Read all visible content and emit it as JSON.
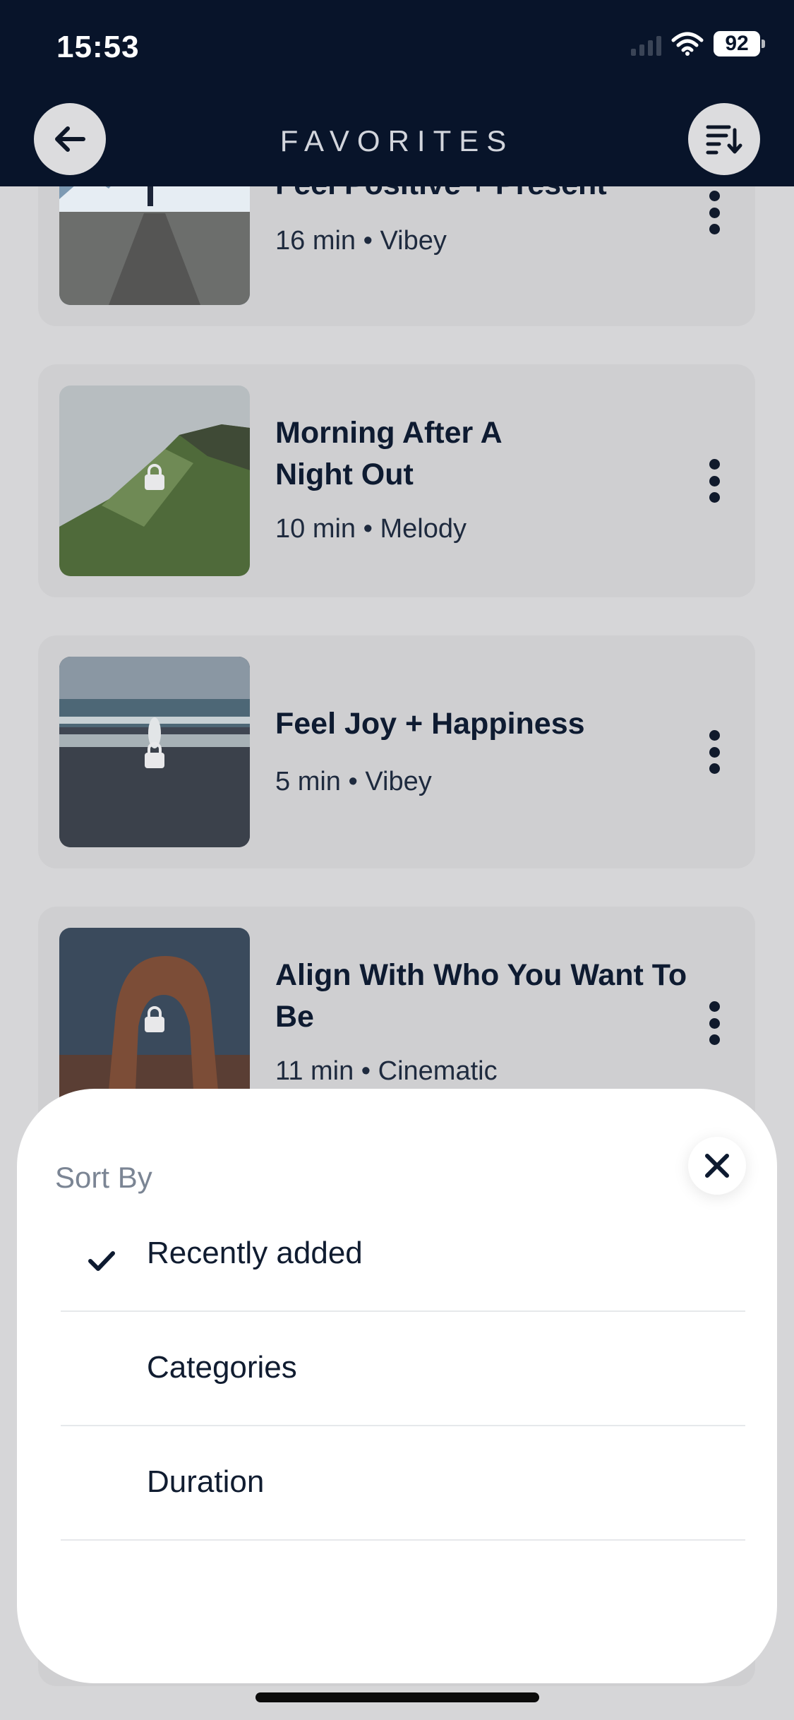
{
  "status_bar": {
    "time": "15:53",
    "battery": "92"
  },
  "header": {
    "title": "FAVORITES",
    "back_icon": "arrow-left-icon",
    "sort_icon": "sort-descending-icon"
  },
  "favorites": [
    {
      "title": "Feel Positive + Present",
      "meta": "16 min • Vibey",
      "thumb": "mountain-road"
    },
    {
      "title": "Morning After A Night Out",
      "meta": "10 min • Melody",
      "thumb": "green-cliff"
    },
    {
      "title": "Feel Joy + Happiness",
      "meta": "5 min • Vibey",
      "thumb": "beach"
    },
    {
      "title": "Align With Who You Want To Be",
      "meta": "11 min • Cinematic",
      "thumb": "rock-arch"
    }
  ],
  "sort_sheet": {
    "title": "Sort By",
    "options": [
      {
        "label": "Recently added",
        "selected": true
      },
      {
        "label": "Categories",
        "selected": false
      },
      {
        "label": "Duration",
        "selected": false
      }
    ]
  },
  "colors": {
    "header_bg": "#08142a",
    "accent_text": "#0e1b31",
    "muted": "#7b8594"
  }
}
